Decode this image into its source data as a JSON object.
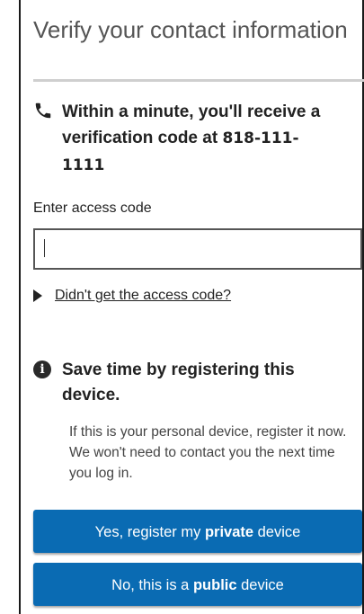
{
  "page": {
    "title": "Verify your contact information"
  },
  "notice": {
    "prefix": "Within a minute, you'll receive a verification code at ",
    "phone": "818-111-1111"
  },
  "access_code": {
    "label": "Enter access code",
    "value": ""
  },
  "disclosure": {
    "link": "Didn't get the access code?"
  },
  "register": {
    "title": "Save time by registering this device.",
    "description": "If this is your personal device, register it now. We won't need to contact you the next time you log in."
  },
  "buttons": {
    "private": {
      "pre": "Yes, register my ",
      "bold": "private",
      "post": " device"
    },
    "public": {
      "pre": "No, this is a ",
      "bold": "public",
      "post": " device"
    }
  },
  "colors": {
    "button_bg": "#0a6bb3",
    "divider": "#cfcfcf"
  },
  "icons": [
    "phone-icon",
    "caret-right-icon",
    "info-icon"
  ]
}
